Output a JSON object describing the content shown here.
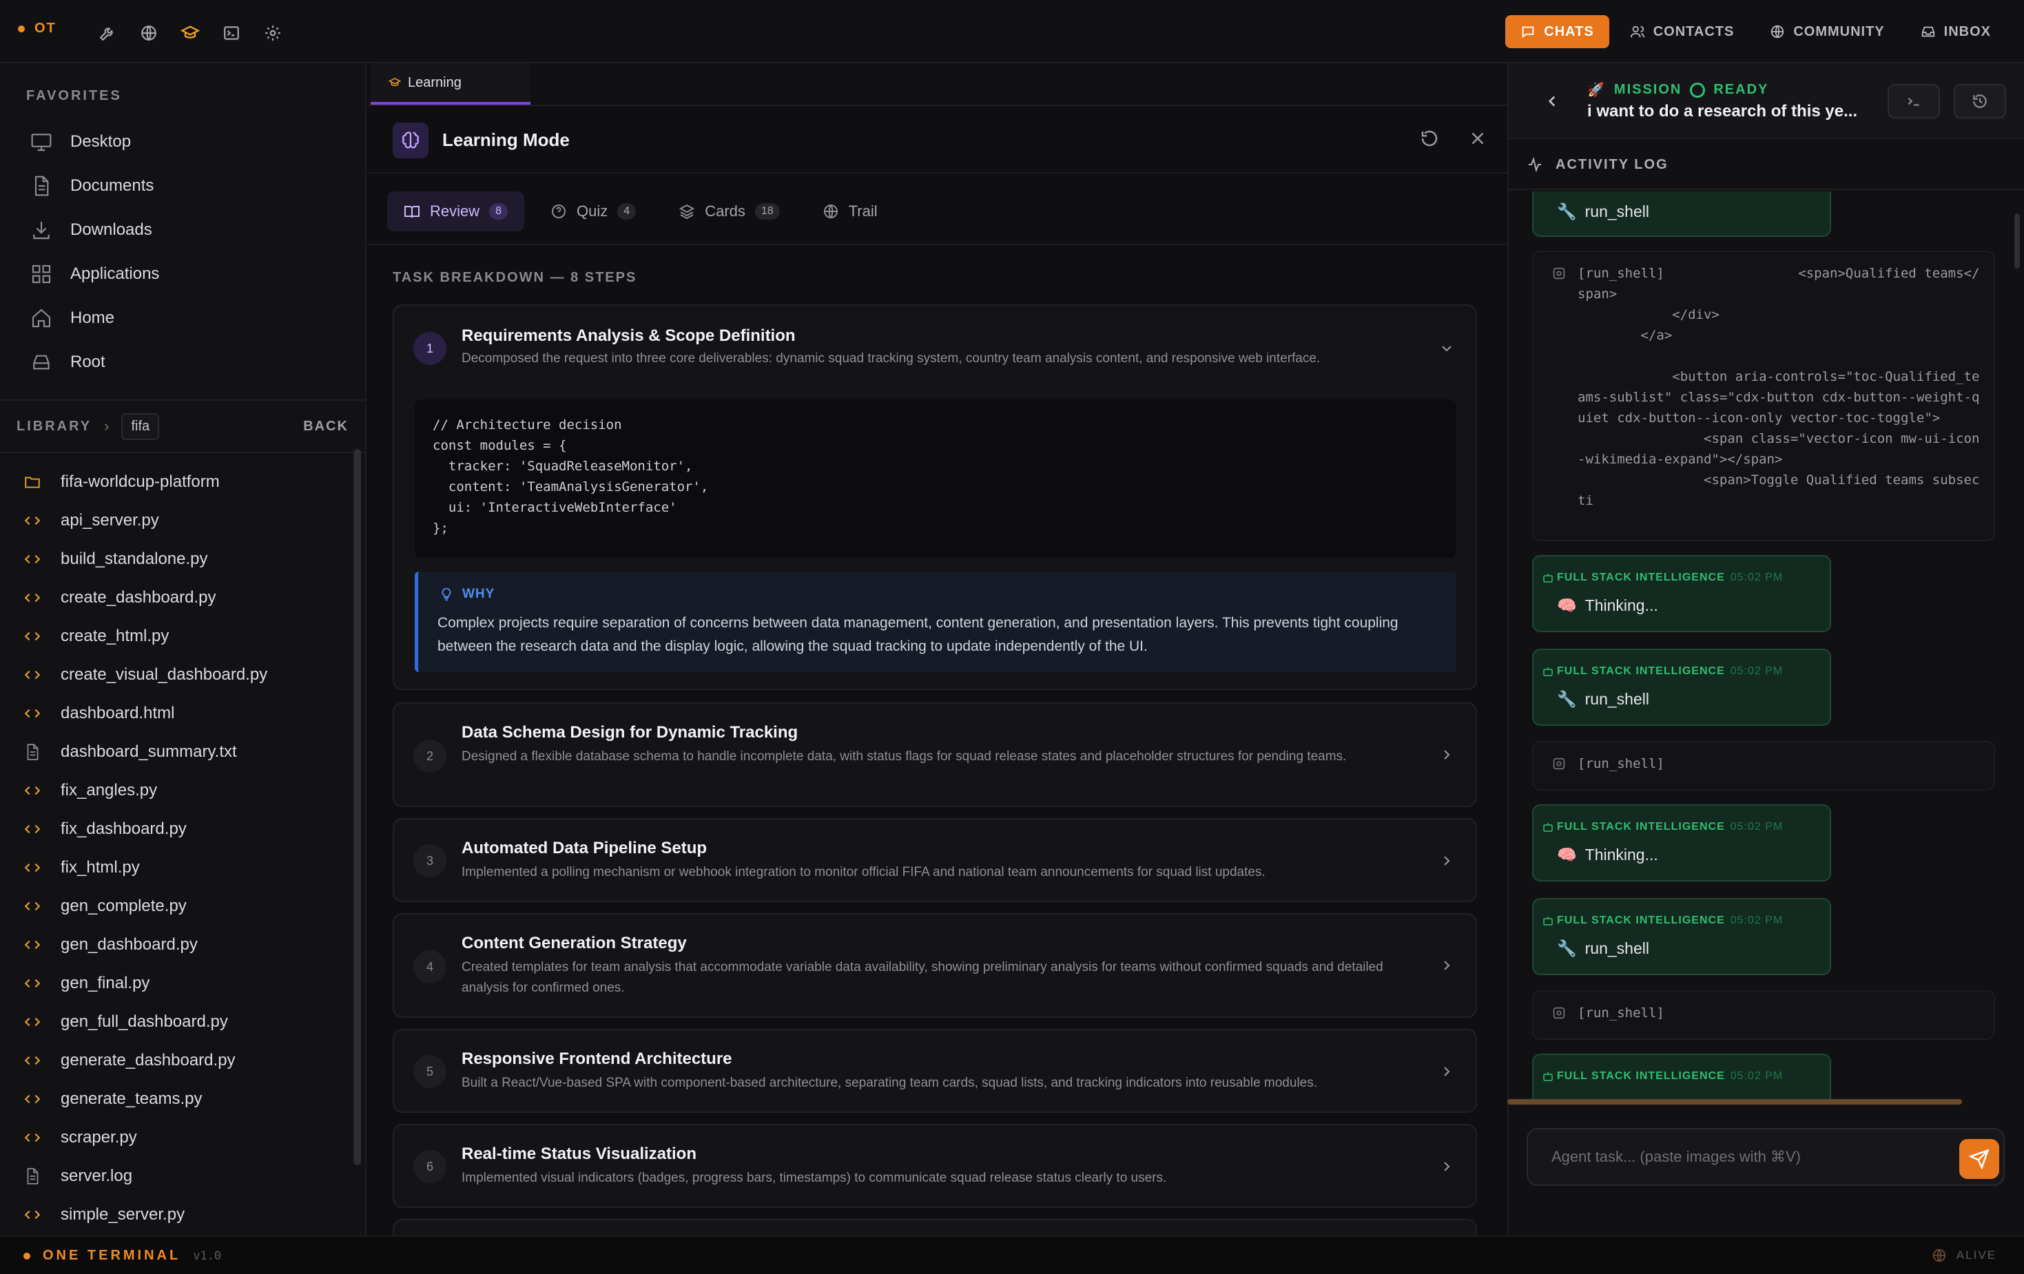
{
  "topbar": {
    "brand": "OT",
    "nav": [
      {
        "label": "CHATS",
        "active": true
      },
      {
        "label": "CONTACTS",
        "active": false
      },
      {
        "label": "COMMUNITY",
        "active": false
      },
      {
        "label": "INBOX",
        "active": false
      }
    ],
    "accent_color": "#e8761d"
  },
  "sidebar": {
    "favorites_title": "FAVORITES",
    "favorites": [
      {
        "label": "Desktop",
        "icon": "monitor-icon"
      },
      {
        "label": "Documents",
        "icon": "document-icon"
      },
      {
        "label": "Downloads",
        "icon": "download-icon"
      },
      {
        "label": "Applications",
        "icon": "grid-icon"
      },
      {
        "label": "Home",
        "icon": "home-icon"
      },
      {
        "label": "Root",
        "icon": "drive-icon"
      }
    ],
    "library_label": "LIBRARY",
    "library_path": "fifa",
    "back_label": "BACK",
    "files": [
      {
        "name": "fifa-worldcup-platform",
        "type": "folder"
      },
      {
        "name": "api_server.py",
        "type": "code"
      },
      {
        "name": "build_standalone.py",
        "type": "code"
      },
      {
        "name": "create_dashboard.py",
        "type": "code"
      },
      {
        "name": "create_html.py",
        "type": "code"
      },
      {
        "name": "create_visual_dashboard.py",
        "type": "code"
      },
      {
        "name": "dashboard.html",
        "type": "code"
      },
      {
        "name": "dashboard_summary.txt",
        "type": "text"
      },
      {
        "name": "fix_angles.py",
        "type": "code"
      },
      {
        "name": "fix_dashboard.py",
        "type": "code"
      },
      {
        "name": "fix_html.py",
        "type": "code"
      },
      {
        "name": "gen_complete.py",
        "type": "code"
      },
      {
        "name": "gen_dashboard.py",
        "type": "code"
      },
      {
        "name": "gen_final.py",
        "type": "code"
      },
      {
        "name": "gen_full_dashboard.py",
        "type": "code"
      },
      {
        "name": "generate_dashboard.py",
        "type": "code"
      },
      {
        "name": "generate_teams.py",
        "type": "code"
      },
      {
        "name": "scraper.py",
        "type": "code"
      },
      {
        "name": "server.log",
        "type": "text"
      },
      {
        "name": "simple_server.py",
        "type": "code"
      }
    ]
  },
  "center": {
    "tab_label": "Learning",
    "title": "Learning Mode",
    "subtabs": [
      {
        "label": "Review",
        "count": "8",
        "active": true
      },
      {
        "label": "Quiz",
        "count": "4",
        "active": false
      },
      {
        "label": "Cards",
        "count": "18",
        "active": false
      },
      {
        "label": "Trail",
        "count": "",
        "active": false
      }
    ],
    "breakdown_title": "TASK BREAKDOWN — 8 STEPS",
    "steps": [
      {
        "num": "1",
        "title": "Requirements Analysis & Scope Definition",
        "desc": "Decomposed the request into three core deliverables: dynamic squad tracking system, country team analysis content, and responsive web interface."
      },
      {
        "num": "2",
        "title": "Data Schema Design for Dynamic Tracking",
        "desc": "Designed a flexible database schema to handle incomplete data, with status flags for squad release states and placeholder structures for pending teams."
      },
      {
        "num": "3",
        "title": "Automated Data Pipeline Setup",
        "desc": "Implemented a polling mechanism or webhook integration to monitor official FIFA and national team announcements for squad list updates."
      },
      {
        "num": "4",
        "title": "Content Generation Strategy",
        "desc": "Created templates for team analysis that accommodate variable data availability, showing preliminary analysis for teams without confirmed squads and detailed analysis for confirmed ones."
      },
      {
        "num": "5",
        "title": "Responsive Frontend Architecture",
        "desc": "Built a React/Vue-based SPA with component-based architecture, separating team cards, squad lists, and tracking indicators into reusable modules."
      },
      {
        "num": "6",
        "title": "Real-time Status Visualization",
        "desc": "Implemented visual indicators (badges, progress bars, timestamps) to communicate squad release status clearly to users."
      }
    ],
    "code": [
      "// Architecture decision",
      "const modules = {",
      "  tracker: 'SquadReleaseMonitor',",
      "  content: 'TeamAnalysisGenerator',",
      "  ui: 'InteractiveWebInterface'",
      "};"
    ],
    "why_label": "WHY",
    "why_text": "Complex projects require separation of concerns between data management, content generation, and presentation layers. This prevents tight coupling between the research data and the display logic, allowing the squad tracking to update independently of the UI."
  },
  "right": {
    "mission_label": "MISSION",
    "status_label": "READY",
    "task": "i want to do a research of this ye...",
    "activity_title": "ACTIVITY LOG",
    "first_tool": "run_shell",
    "shell_output": "[run_shell]                 <span>Qualified teams</span>\n            </div>\n        </a>\n\n            <button aria-controls=\"toc-Qualified_teams-sublist\" class=\"cdx-button cdx-button--weight-quiet cdx-button--icon-only vector-toc-toggle\">\n                <span class=\"vector-icon mw-ui-icon-wikimedia-expand\"></span>\n                <span>Toggle Qualified teams subsecti",
    "agent_name": "FULL STACK INTELLIGENCE",
    "agent_time": "05:02 PM",
    "entries": [
      {
        "kind": "msg",
        "text": "Thinking...",
        "icon": "brain-icon"
      },
      {
        "kind": "msg",
        "text": "run_shell",
        "icon": "wrench-icon"
      },
      {
        "kind": "tool",
        "text": "[run_shell]"
      },
      {
        "kind": "msg",
        "text": "Thinking...",
        "icon": "brain-icon"
      },
      {
        "kind": "msg",
        "text": "run_shell",
        "icon": "wrench-icon"
      },
      {
        "kind": "tool",
        "text": "[run_shell]"
      },
      {
        "kind": "msg",
        "text": "",
        "icon": ""
      }
    ],
    "input_placeholder": "Agent task... (paste images with ⌘V)",
    "success_color": "#2fbf71"
  },
  "statusbar": {
    "name": "ONE TERMINAL",
    "version": "v1.0",
    "status": "ALIVE"
  }
}
